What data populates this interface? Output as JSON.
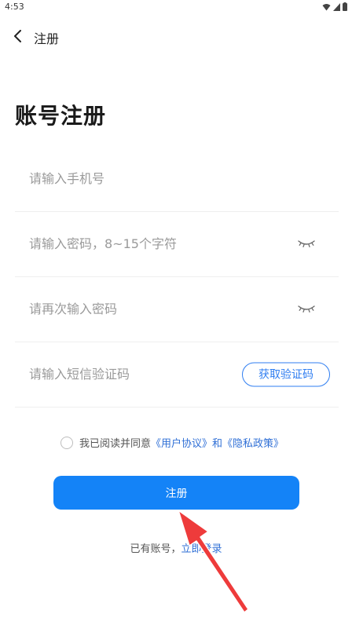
{
  "status_bar": {
    "time": "4:53"
  },
  "nav": {
    "title": "注册"
  },
  "page": {
    "title": "账号注册"
  },
  "form": {
    "phone_placeholder": "请输入手机号",
    "password_placeholder": "请输入密码，8~15个字符",
    "confirm_placeholder": "请再次输入密码",
    "code_placeholder": "请输入短信验证码",
    "get_code_label": "获取验证码"
  },
  "agreement": {
    "prefix": "我已阅读并同意",
    "user_agreement": "《用户协议》",
    "and": "和",
    "privacy_policy": "《隐私政策》",
    "checked": false
  },
  "register_button": {
    "label": "注册"
  },
  "login": {
    "prompt": "已有账号，",
    "link": "立即登录"
  },
  "colors": {
    "primary": "#1483f7",
    "link": "#2f6fd6",
    "annotation_arrow": "#ee3b3b"
  }
}
